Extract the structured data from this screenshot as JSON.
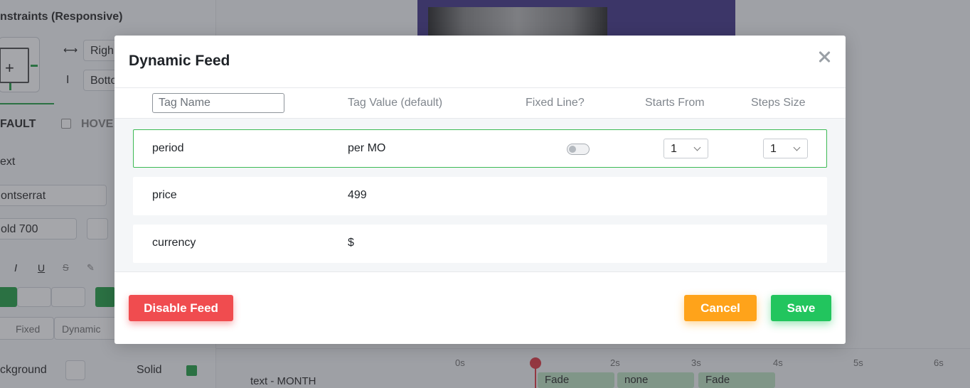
{
  "background": {
    "panel_title": "nstraints (Responsive)",
    "constraint_h_value": "Righ",
    "constraint_v_value": "Botto",
    "state_default": "FAULT",
    "state_hover": "HOVE",
    "section_text": "ext",
    "font_family": "ontserrat",
    "font_weight": "old 700",
    "size_fixed": "Fixed",
    "size_dynamic": "Dynamic",
    "background_label": "ckground",
    "background_mode": "Solid",
    "timeline_layer": "text - MONTH",
    "ticks": [
      "0s",
      "2s",
      "3s",
      "4s",
      "5s",
      "6s"
    ],
    "blocks": [
      "Fade",
      "none",
      "Fade"
    ]
  },
  "modal": {
    "title": "Dynamic Feed",
    "columns": {
      "tag_name_placeholder": "Tag Name",
      "tag_value": "Tag Value (default)",
      "fixed_line": "Fixed Line?",
      "starts_from": "Starts From",
      "steps_size": "Steps Size"
    },
    "rows": [
      {
        "name": "period",
        "value": "per MO",
        "fixed_line": false,
        "starts_from": "1",
        "steps_size": "1"
      },
      {
        "name": "price",
        "value": "499"
      },
      {
        "name": "currency",
        "value": "$"
      }
    ],
    "buttons": {
      "disable": "Disable Feed",
      "cancel": "Cancel",
      "save": "Save"
    },
    "colors": {
      "disable": "#f04c4f",
      "cancel": "#ffa31a",
      "save": "#22c55e",
      "active_row_border": "#3cba54"
    }
  }
}
